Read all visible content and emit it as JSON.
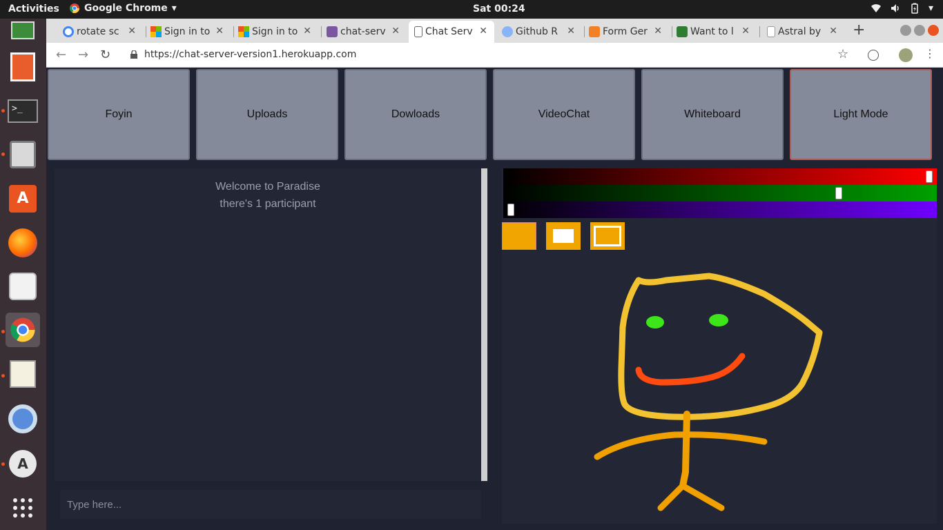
{
  "system": {
    "activities": "Activities",
    "app_name": "Google Chrome",
    "clock": "Sat 00:24"
  },
  "browser": {
    "tabs": [
      {
        "title": "rotate sc",
        "icon": "google-icon"
      },
      {
        "title": "Sign in to",
        "icon": "microsoft-icon"
      },
      {
        "title": "Sign in to",
        "icon": "microsoft-icon"
      },
      {
        "title": "chat-serv",
        "icon": "heroku-icon"
      },
      {
        "title": "Chat Serv",
        "icon": "page-icon"
      },
      {
        "title": "Github R",
        "icon": "github-icon"
      },
      {
        "title": "Form Ger",
        "icon": "form-icon"
      },
      {
        "title": "Want to l",
        "icon": "android-icon"
      },
      {
        "title": "Astral by",
        "icon": "page-icon"
      }
    ],
    "url": "https://chat-server-version1.herokuapp.com"
  },
  "nav": {
    "buttons": [
      "Foyin",
      "Uploads",
      "Dowloads",
      "VideoChat",
      "Whiteboard",
      "Light Mode"
    ]
  },
  "chat": {
    "welcome": "Welcome to Paradise",
    "participants": "there's 1 participant",
    "input_placeholder": "Type here..."
  },
  "whiteboard": {
    "red": 255,
    "green": 200,
    "blue": 0,
    "tools": [
      "fill-tool",
      "rectangle-fill-tool",
      "rectangle-outline-tool"
    ],
    "brush_color": "#f0a500"
  },
  "colors": {
    "page_bg": "#1f2230",
    "panel_bg": "#232634",
    "button_bg": "#848a99"
  }
}
